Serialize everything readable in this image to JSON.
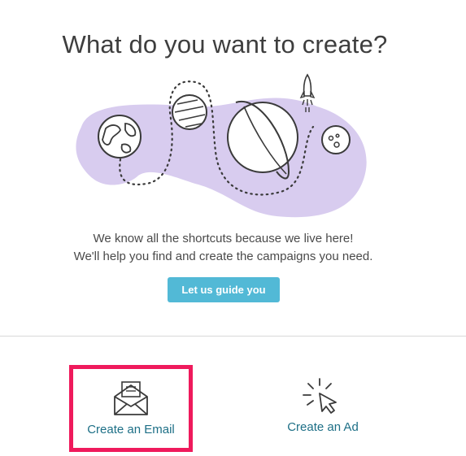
{
  "header": {
    "title": "What do you want to create?"
  },
  "intro": {
    "line1": "We know all the shortcuts because we live here!",
    "line2": "We'll help you find and create the campaigns you need."
  },
  "guide_button": {
    "label": "Let us guide you"
  },
  "choices": [
    {
      "label": "Create an Email",
      "icon": "envelope-icon",
      "highlighted": true
    },
    {
      "label": "Create an Ad",
      "icon": "cursor-click-icon",
      "highlighted": false
    }
  ],
  "colors": {
    "title": "#3e3e3e",
    "button": "#52b9d6",
    "link": "#1d6f86",
    "highlight": "#ef1a5c",
    "blob": "#d8ccef"
  }
}
